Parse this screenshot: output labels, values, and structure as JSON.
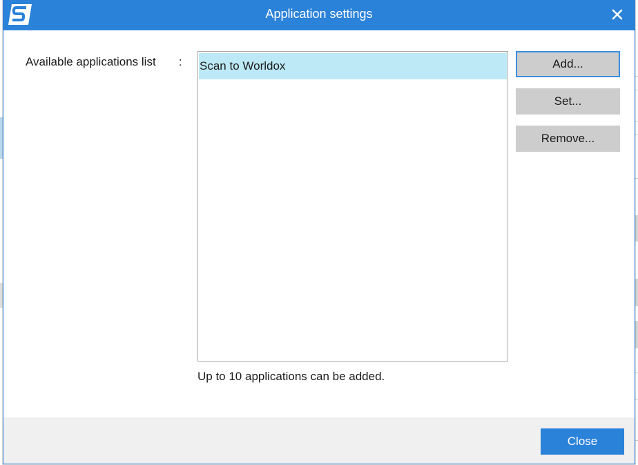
{
  "window": {
    "title": "Application settings",
    "logo_icon": "scansnap-logo-icon",
    "close_icon": "close-icon"
  },
  "main": {
    "list_label": "Available applications list",
    "colon": ":",
    "applications": [
      "Scan to Worldox"
    ],
    "hint": "Up to 10 applications can be added."
  },
  "buttons": {
    "add_label": "Add...",
    "set_label": "Set...",
    "remove_label": "Remove..."
  },
  "footer": {
    "close_label": "Close"
  },
  "colors": {
    "accent": "#2b82d9",
    "selection": "#bde9f7",
    "button_gray": "#cdcdcd"
  }
}
